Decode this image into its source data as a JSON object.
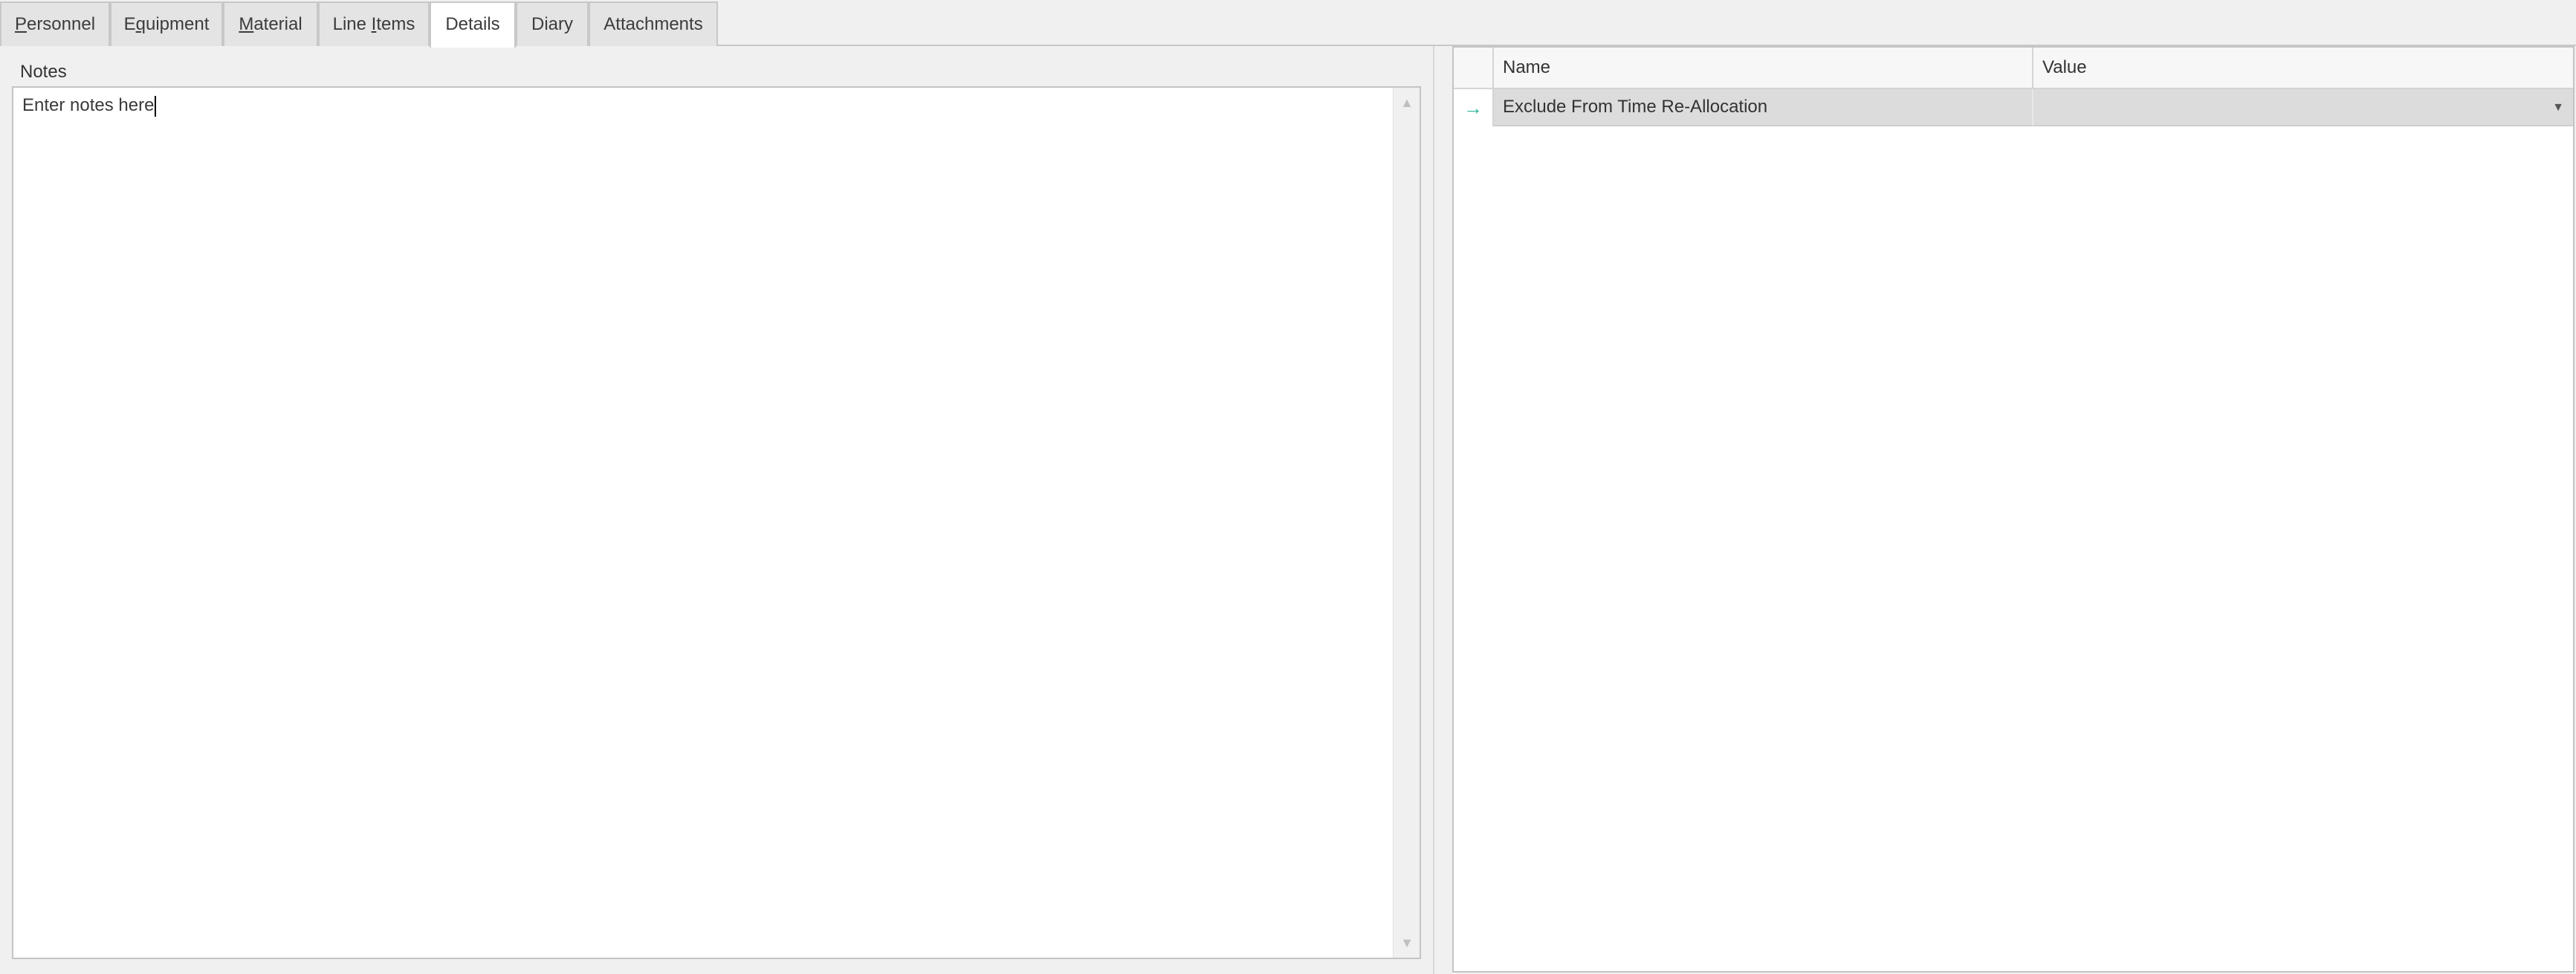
{
  "tabs": [
    {
      "id": "personnel",
      "pre": "",
      "mnemonic": "P",
      "post": "ersonnel",
      "active": false
    },
    {
      "id": "equipment",
      "pre": "E",
      "mnemonic": "q",
      "post": "uipment",
      "active": false
    },
    {
      "id": "material",
      "pre": "",
      "mnemonic": "M",
      "post": "aterial",
      "active": false
    },
    {
      "id": "line-items",
      "pre": "Line ",
      "mnemonic": "I",
      "post": "tems",
      "active": false
    },
    {
      "id": "details",
      "pre": "Details",
      "mnemonic": "",
      "post": "",
      "active": true
    },
    {
      "id": "diary",
      "pre": "Diary",
      "mnemonic": "",
      "post": "",
      "active": false
    },
    {
      "id": "attachments",
      "pre": "Attachments",
      "mnemonic": "",
      "post": "",
      "active": false
    }
  ],
  "notes": {
    "label": "Notes",
    "value": "Enter notes here"
  },
  "grid": {
    "columns": {
      "name": "Name",
      "value": "Value"
    },
    "rows": [
      {
        "name": "Exclude From Time Re-Allocation",
        "value": ""
      }
    ],
    "row_indicator_icon": "arrow-right-icon"
  },
  "icons": {
    "scroll_up": "▲",
    "scroll_down": "▼",
    "row_indicator": "→",
    "dropdown": "▼"
  },
  "colors": {
    "accent_indicator": "#2bb39a",
    "selected_row": "#dcdcdc",
    "background": "#f0f0f0"
  }
}
